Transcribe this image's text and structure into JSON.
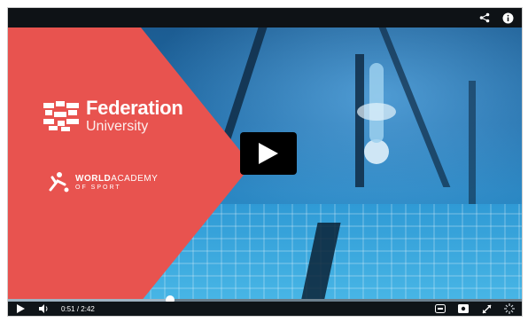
{
  "branding": {
    "federation_line1": "Federation",
    "federation_line2": "University",
    "academy_world": "WORLD",
    "academy_academy": "ACADEMY",
    "academy_line2": "OF SPORT"
  },
  "player": {
    "current_time": "0:51",
    "duration": "/ 2:42",
    "progress_fraction": 0.315
  },
  "icons": {
    "share": "share-icon",
    "info": "info-icon",
    "play": "play-icon",
    "volume": "volume-icon",
    "captions": "captions-icon",
    "watch_later": "watch-later-icon",
    "fullscreen": "fullscreen-icon",
    "settings": "settings-icon"
  },
  "colors": {
    "panel_red": "#e8534f",
    "water_blue": "#2a86c2",
    "control_bar": "#0f1418"
  }
}
